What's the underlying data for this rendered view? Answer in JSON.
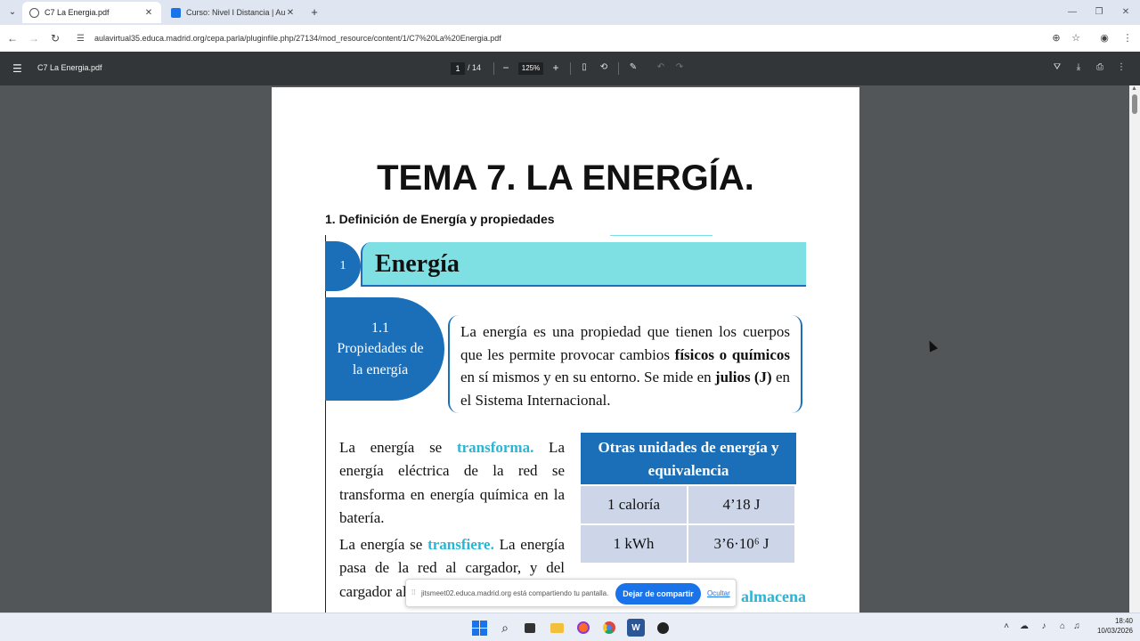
{
  "browser": {
    "tabs": [
      {
        "label": "C7 La Energia.pdf",
        "active": true
      },
      {
        "label": "Curso: Nivel I Distancia | AulaVi",
        "active": false
      }
    ],
    "new_tab": "+",
    "url": "aulavirtual35.educa.madrid.org/cepa.parla/pluginfile.php/27134/mod_resource/content/1/C7%20La%20Energia.pdf"
  },
  "pdf_viewer": {
    "title": "C7 La Energia.pdf",
    "page_current": "1",
    "page_total": "/ 14",
    "zoom": "125%"
  },
  "document": {
    "title": "TEMA 7. LA ENERGÍA.",
    "section": "1. Definición de Energía y propiedades",
    "banner_number": "1",
    "banner_title": "Energía",
    "prop_heading": "1.1 Propiedades de la energía",
    "prop_text_1": "La energía es una propiedad que tienen los cuerpos que les permite provocar cambios ",
    "prop_text_bold_1": "físicos o químicos",
    "prop_text_2": " en sí mismos y en su entorno. Se mide en ",
    "prop_text_bold_2": "julios (J)",
    "prop_text_3": " en el Sistema Internacional.",
    "transforma_pre": "La energía se ",
    "transforma_kw": "transforma.",
    "transforma_post": " La energía eléctrica de la red se transforma en energía química en la batería.",
    "transfiere_pre": "La energía se ",
    "transfiere_kw": "transfiere.",
    "transfiere_post": " La energía pasa de la red al cargador, y del cargador al móvil",
    "almacena_kw": "almacena",
    "units_heading": "Otras unidades de energía y equivalencia",
    "units": [
      {
        "unit": "1 caloría",
        "value": "4’18 J"
      },
      {
        "unit": "1 kWh",
        "value": "3’6·10⁶ J"
      }
    ]
  },
  "screen_share": {
    "message": "jitsmeet02.educa.madrid.org está compartiendo tu pantalla.",
    "stop_label": "Dejar de compartir",
    "hide_label": "Ocultar"
  },
  "taskbar": {
    "time": "18:40",
    "date": "10/03/2026"
  },
  "colors": {
    "accent_blue": "#1a6fb8",
    "cyan": "#7fe0e3",
    "keyword_cyan": "#29b5d4",
    "viewer_dark": "#323639"
  }
}
